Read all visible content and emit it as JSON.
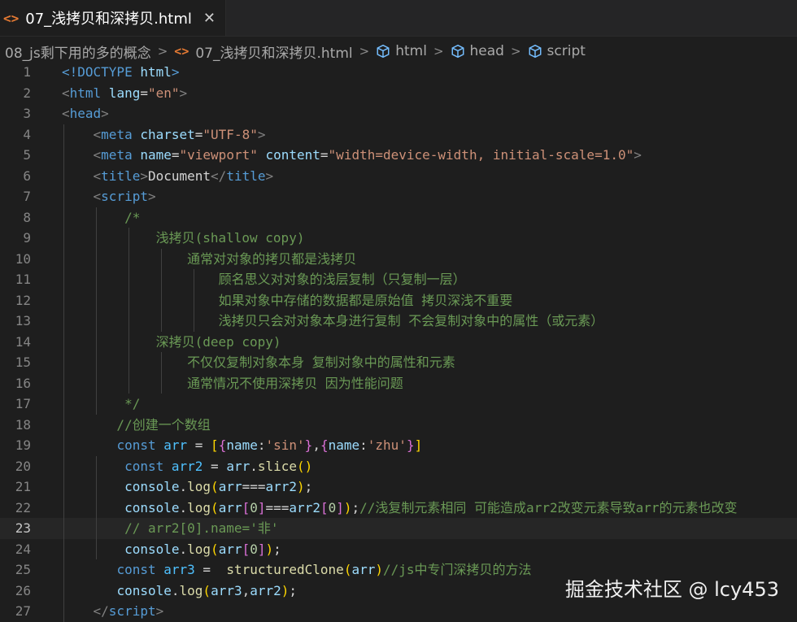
{
  "tab": {
    "icon": "<>",
    "label": "07_浅拷贝和深拷贝.html",
    "close": "✕"
  },
  "breadcrumb": {
    "folder": "08_js剩下用的多的概念",
    "file": "07_浅拷贝和深拷贝.html",
    "html": "html",
    "head": "head",
    "script": "script",
    "separator": ">"
  },
  "active_line": 23,
  "lines": [
    {
      "n": "1",
      "tokens": [
        [
          "<!",
          "t-tag"
        ],
        [
          "DOCTYPE",
          "t-tag"
        ],
        [
          " html",
          "t-attr"
        ],
        [
          ">",
          "t-tag"
        ]
      ]
    },
    {
      "n": "2",
      "tokens": [
        [
          "<",
          "t-punc"
        ],
        [
          "html",
          "t-tag"
        ],
        [
          " lang",
          "t-attr"
        ],
        [
          "=",
          "t-text"
        ],
        [
          "\"en\"",
          "t-str"
        ],
        [
          ">",
          "t-punc"
        ]
      ]
    },
    {
      "n": "3",
      "tokens": [
        [
          "<",
          "t-punc"
        ],
        [
          "head",
          "t-tag"
        ],
        [
          ">",
          "t-punc"
        ]
      ]
    },
    {
      "n": "4",
      "tokens": [
        [
          "    ",
          "t-text"
        ],
        [
          "<",
          "t-punc"
        ],
        [
          "meta",
          "t-tag"
        ],
        [
          " charset",
          "t-attr"
        ],
        [
          "=",
          "t-text"
        ],
        [
          "\"UTF-8\"",
          "t-str"
        ],
        [
          ">",
          "t-punc"
        ]
      ]
    },
    {
      "n": "5",
      "tokens": [
        [
          "    ",
          "t-text"
        ],
        [
          "<",
          "t-punc"
        ],
        [
          "meta",
          "t-tag"
        ],
        [
          " name",
          "t-attr"
        ],
        [
          "=",
          "t-text"
        ],
        [
          "\"viewport\"",
          "t-str"
        ],
        [
          " content",
          "t-attr"
        ],
        [
          "=",
          "t-text"
        ],
        [
          "\"width=device-width, initial-scale=1.0\"",
          "t-str"
        ],
        [
          ">",
          "t-punc"
        ]
      ]
    },
    {
      "n": "6",
      "tokens": [
        [
          "    ",
          "t-text"
        ],
        [
          "<",
          "t-punc"
        ],
        [
          "title",
          "t-tag"
        ],
        [
          ">",
          "t-punc"
        ],
        [
          "Document",
          "t-text"
        ],
        [
          "</",
          "t-punc"
        ],
        [
          "title",
          "t-tag"
        ],
        [
          ">",
          "t-punc"
        ]
      ]
    },
    {
      "n": "7",
      "tokens": [
        [
          "    ",
          "t-text"
        ],
        [
          "<",
          "t-punc"
        ],
        [
          "script",
          "t-tag"
        ],
        [
          ">",
          "t-punc"
        ]
      ]
    },
    {
      "n": "8",
      "tokens": [
        [
          "        /*",
          "t-cmt"
        ]
      ]
    },
    {
      "n": "9",
      "tokens": [
        [
          "            浅拷贝(shallow copy)",
          "t-cmt"
        ]
      ]
    },
    {
      "n": "10",
      "tokens": [
        [
          "                通常对对象的拷贝都是浅拷贝",
          "t-cmt"
        ]
      ]
    },
    {
      "n": "11",
      "tokens": [
        [
          "                    顾名思义对对象的浅层复制（只复制一层）",
          "t-cmt"
        ]
      ]
    },
    {
      "n": "12",
      "tokens": [
        [
          "                    如果对象中存储的数据都是原始值 拷贝深浅不重要",
          "t-cmt"
        ]
      ]
    },
    {
      "n": "13",
      "tokens": [
        [
          "                    浅拷贝只会对对象本身进行复制 不会复制对象中的属性（或元素）",
          "t-cmt"
        ]
      ]
    },
    {
      "n": "14",
      "tokens": [
        [
          "            深拷贝(deep copy)",
          "t-cmt"
        ]
      ]
    },
    {
      "n": "15",
      "tokens": [
        [
          "                不仅仅复制对象本身 复制对象中的属性和元素",
          "t-cmt"
        ]
      ]
    },
    {
      "n": "16",
      "tokens": [
        [
          "                通常情况不使用深拷贝 因为性能问题",
          "t-cmt"
        ]
      ]
    },
    {
      "n": "17",
      "tokens": [
        [
          "        */",
          "t-cmt"
        ]
      ]
    },
    {
      "n": "18",
      "tokens": [
        [
          "       //创建一个数组",
          "t-cmt"
        ]
      ]
    },
    {
      "n": "19",
      "tokens": [
        [
          "       ",
          "t-text"
        ],
        [
          "const",
          "t-kw"
        ],
        [
          " arr",
          "t-var"
        ],
        [
          " = ",
          "t-op"
        ],
        [
          "[",
          "t-br"
        ],
        [
          "{",
          "t-br2"
        ],
        [
          "name",
          "t-prop"
        ],
        [
          ":",
          "t-op"
        ],
        [
          "'sin'",
          "t-str"
        ],
        [
          "}",
          "t-br2"
        ],
        [
          ",",
          "t-op"
        ],
        [
          "{",
          "t-br2"
        ],
        [
          "name",
          "t-prop"
        ],
        [
          ":",
          "t-op"
        ],
        [
          "'zhu'",
          "t-str"
        ],
        [
          "}",
          "t-br2"
        ],
        [
          "]",
          "t-br"
        ]
      ]
    },
    {
      "n": "20",
      "tokens": [
        [
          "        ",
          "t-text"
        ],
        [
          "const",
          "t-kw"
        ],
        [
          " arr2",
          "t-var"
        ],
        [
          " = ",
          "t-op"
        ],
        [
          "arr",
          "t-prop"
        ],
        [
          ".",
          "t-op"
        ],
        [
          "slice",
          "t-fn"
        ],
        [
          "()",
          "t-br"
        ]
      ]
    },
    {
      "n": "21",
      "tokens": [
        [
          "        ",
          "t-text"
        ],
        [
          "console",
          "t-prop"
        ],
        [
          ".",
          "t-op"
        ],
        [
          "log",
          "t-fn"
        ],
        [
          "(",
          "t-br"
        ],
        [
          "arr",
          "t-prop"
        ],
        [
          "===",
          "t-op"
        ],
        [
          "arr2",
          "t-prop"
        ],
        [
          ")",
          "t-br"
        ],
        [
          ";",
          "t-op"
        ]
      ]
    },
    {
      "n": "22",
      "tokens": [
        [
          "        ",
          "t-text"
        ],
        [
          "console",
          "t-prop"
        ],
        [
          ".",
          "t-op"
        ],
        [
          "log",
          "t-fn"
        ],
        [
          "(",
          "t-br"
        ],
        [
          "arr",
          "t-prop"
        ],
        [
          "[",
          "t-br2"
        ],
        [
          "0",
          "t-num"
        ],
        [
          "]",
          "t-br2"
        ],
        [
          "===",
          "t-op"
        ],
        [
          "arr2",
          "t-prop"
        ],
        [
          "[",
          "t-br2"
        ],
        [
          "0",
          "t-num"
        ],
        [
          "]",
          "t-br2"
        ],
        [
          ")",
          "t-br"
        ],
        [
          ";",
          "t-op"
        ],
        [
          "//浅复制元素相同 可能造成arr2改变元素导致arr的元素也改变",
          "t-cmt"
        ]
      ]
    },
    {
      "n": "23",
      "tokens": [
        [
          "        // arr2[0].name='非'",
          "t-cmt"
        ]
      ]
    },
    {
      "n": "24",
      "tokens": [
        [
          "        ",
          "t-text"
        ],
        [
          "console",
          "t-prop"
        ],
        [
          ".",
          "t-op"
        ],
        [
          "log",
          "t-fn"
        ],
        [
          "(",
          "t-br"
        ],
        [
          "arr",
          "t-prop"
        ],
        [
          "[",
          "t-br2"
        ],
        [
          "0",
          "t-num"
        ],
        [
          "]",
          "t-br2"
        ],
        [
          ")",
          "t-br"
        ],
        [
          ";",
          "t-op"
        ]
      ]
    },
    {
      "n": "25",
      "tokens": [
        [
          "       ",
          "t-text"
        ],
        [
          "const",
          "t-kw"
        ],
        [
          " arr3",
          "t-var"
        ],
        [
          " =  ",
          "t-op"
        ],
        [
          "structuredClone",
          "t-fn"
        ],
        [
          "(",
          "t-br"
        ],
        [
          "arr",
          "t-prop"
        ],
        [
          ")",
          "t-br"
        ],
        [
          "//js中专门深拷贝的方法",
          "t-cmt"
        ]
      ]
    },
    {
      "n": "26",
      "tokens": [
        [
          "       ",
          "t-text"
        ],
        [
          "console",
          "t-prop"
        ],
        [
          ".",
          "t-op"
        ],
        [
          "log",
          "t-fn"
        ],
        [
          "(",
          "t-br"
        ],
        [
          "arr3",
          "t-prop"
        ],
        [
          ",",
          "t-op"
        ],
        [
          "arr2",
          "t-prop"
        ],
        [
          ")",
          "t-br"
        ],
        [
          ";",
          "t-op"
        ]
      ]
    },
    {
      "n": "27",
      "tokens": [
        [
          "    ",
          "t-text"
        ],
        [
          "</",
          "t-punc"
        ],
        [
          "script",
          "t-tag"
        ],
        [
          ">",
          "t-punc"
        ]
      ]
    }
  ],
  "watermark": "掘金技术社区 @ lcy453"
}
